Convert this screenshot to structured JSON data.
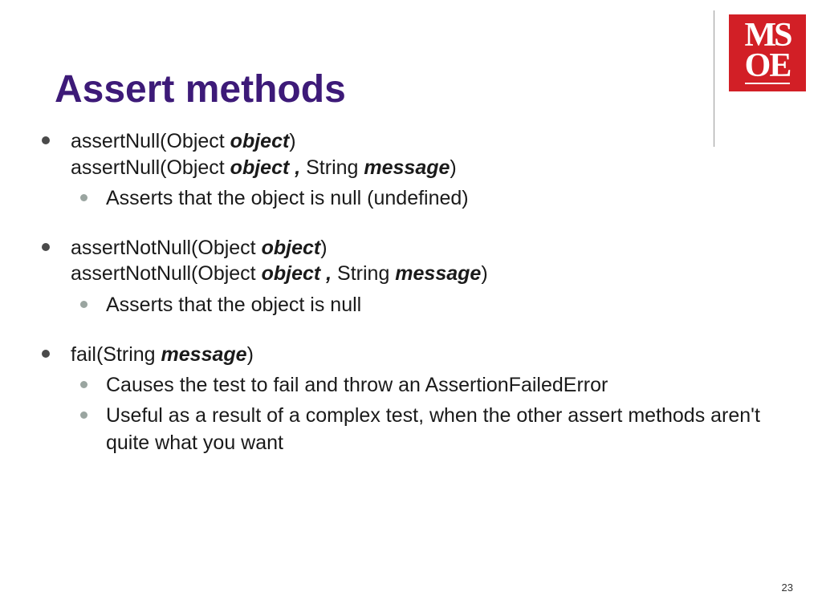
{
  "logo": {
    "line1": "MS",
    "line2": "OE"
  },
  "title": "Assert methods",
  "bullets": [
    {
      "sig1": {
        "pre": "assertNull(Object ",
        "em": "object",
        "post": ")"
      },
      "sig2": {
        "pre": "assertNull(Object ",
        "em": "object ,",
        "mid": " String ",
        "em2": "message",
        "post": ")"
      },
      "subs": [
        "Asserts that the object is null (undefined)"
      ]
    },
    {
      "sig1": {
        "pre": "assertNotNull(Object ",
        "em": "object",
        "post": ")"
      },
      "sig2": {
        "pre": "assertNotNull(Object ",
        "em": "object ,",
        "mid": " String ",
        "em2": "message",
        "post": ")"
      },
      "subs": [
        "Asserts that the object is null"
      ]
    },
    {
      "sig1": {
        "pre": "fail(String ",
        "em": "message",
        "post": ")"
      },
      "subs": [
        "Causes the test to fail and throw an AssertionFailedError",
        "Useful as a result of a complex test, when the other assert methods aren't quite what you want"
      ]
    }
  ],
  "page_number": "23"
}
